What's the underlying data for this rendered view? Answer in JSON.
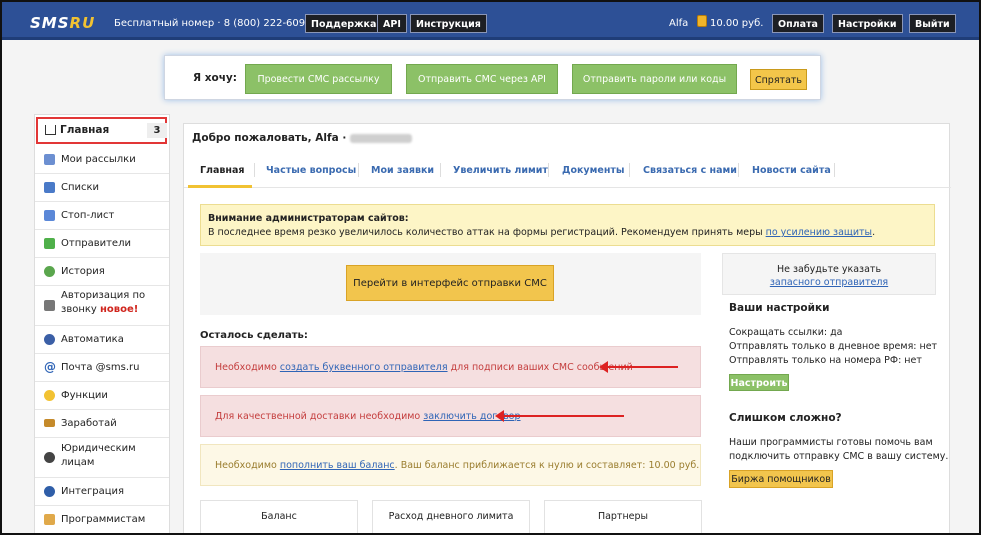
{
  "header": {
    "logo_text": "SMS",
    "logo_accent": "RU",
    "phone_text": "Бесплатный номер · 8 (800) 222-6095",
    "support": "Поддержка",
    "api": "API",
    "manual": "Инструкция",
    "user": "Alfa",
    "balance": "10.00 руб.",
    "pay": "Оплата",
    "settings": "Настройки",
    "logout": "Выйти"
  },
  "want": {
    "label": "Я хочу:",
    "b1": "Провести СМС рассылку",
    "b2": "Отправить СМС через API",
    "b3": "Отправить пароли или коды",
    "hide": "Спрятать"
  },
  "sidebar": {
    "items": [
      {
        "label": "Главная",
        "icon": "home-icon",
        "badge": "3"
      },
      {
        "label": "Мои рассылки",
        "icon": "mailings-icon"
      },
      {
        "label": "Списки",
        "icon": "list-icon"
      },
      {
        "label": "Стоп-лист",
        "icon": "stoplist-icon"
      },
      {
        "label": "Отправители",
        "icon": "tag-icon"
      },
      {
        "label": "История",
        "icon": "history-icon"
      },
      {
        "label": "Авторизация по",
        "label2": "звонку",
        "new": "новое!",
        "icon": "phone-icon"
      },
      {
        "label": "Автоматика",
        "icon": "automation-icon"
      },
      {
        "label": "Почта @sms.ru",
        "icon": "at-icon"
      },
      {
        "label": "Функции",
        "icon": "bulb-icon"
      },
      {
        "label": "Заработай",
        "icon": "money-icon"
      },
      {
        "label": "Юридическим",
        "label2": "лицам",
        "icon": "person-icon"
      },
      {
        "label": "Интеграция",
        "icon": "integration-icon"
      },
      {
        "label": "Программистам",
        "icon": "hand-icon"
      }
    ]
  },
  "main": {
    "welcome": "Добро пожаловать, Alfa ·",
    "tabs": [
      "Главная",
      "Частые вопросы",
      "Мои заявки",
      "Увеличить лимит",
      "Документы",
      "Связаться с нами",
      "Новости сайта"
    ],
    "warn_title": "Внимание администраторам сайтов:",
    "warn_text": "В последнее время резко увеличилось количество аттак на формы регистраций. Рекомендуем принять меры",
    "warn_link": "по усилению защиты",
    "warn_end": ".",
    "send_button": "Перейти в интерфейс отправки СМС",
    "todo": "Осталось сделать:",
    "todo1_pre": "Необходимо",
    "todo1_link": "создать буквенного отправителя",
    "todo1_post": "для подписи ваших СМС сообщений",
    "todo2_pre": "Для качественной доставки необходимо",
    "todo2_link": "заключить договор",
    "todo3_pre": "Необходимо",
    "todo3_link": "пополнить ваш баланс",
    "todo3_post": ". Ваш баланс приближается к нулю и составляет: 10.00 руб.",
    "stats": [
      "Баланс",
      "Расход дневного лимита",
      "Партнеры"
    ]
  },
  "right": {
    "remember": "Не забудьте указать",
    "reserve_link": "запасного отправителя",
    "settings_title": "Ваши настройки",
    "s1": "Сокращать ссылки:  да",
    "s2": "Отправлять только в дневное время:  нет",
    "s3": "Отправлять только на номера РФ:  нет",
    "configure": "Настроить",
    "hard_title": "Слишком сложно?",
    "hard1": "Наши программисты готовы помочь вам",
    "hard2": "подключить отправку СМС в вашу систему.",
    "exchange": "Биржа помощников"
  }
}
